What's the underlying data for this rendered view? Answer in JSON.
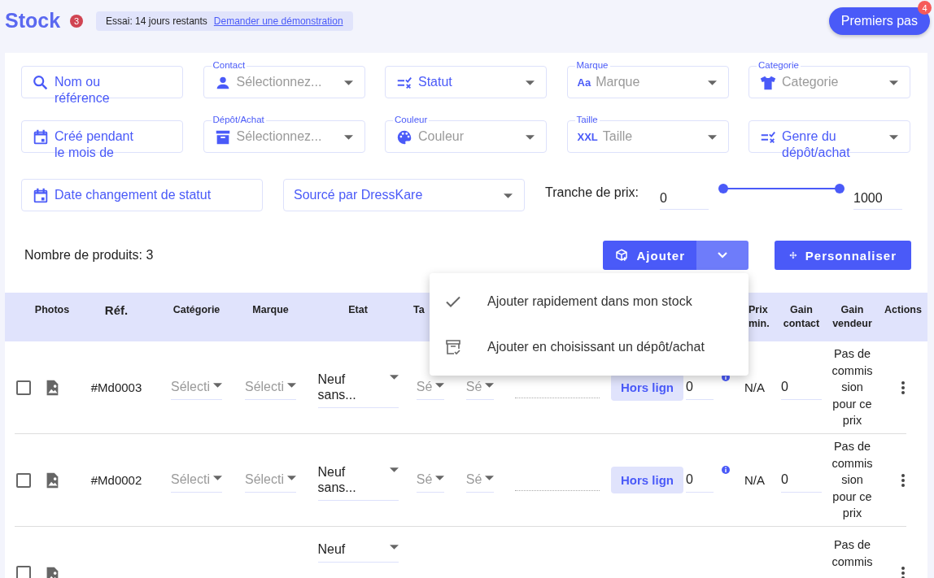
{
  "page": {
    "title": "Stock",
    "notification_count": "3"
  },
  "trial": {
    "text": "Essai: 14 jours restants",
    "link": "Demander une démonstration"
  },
  "help_button": {
    "label": "Premiers pas",
    "badge": "4"
  },
  "filters": [
    {
      "kind": "search",
      "text": "Nom ou référence"
    },
    {
      "kind": "contact",
      "label": "Contact",
      "placeholder": "Sélectionnez..."
    },
    {
      "kind": "status",
      "text": "Statut"
    },
    {
      "kind": "brand",
      "label": "Marque",
      "icon_text": "Aa",
      "placeholder": "Marque"
    },
    {
      "kind": "category",
      "label": "Categorie",
      "placeholder": "Categorie"
    },
    {
      "kind": "month",
      "text": "Créé pendant le mois de"
    },
    {
      "kind": "deposit",
      "label": "Dépôt/Achat",
      "placeholder": "Sélectionnez..."
    },
    {
      "kind": "color",
      "label": "Couleur",
      "placeholder": "Couleur"
    },
    {
      "kind": "size",
      "label": "Taille",
      "icon_text": "XXL",
      "placeholder": "Taille"
    },
    {
      "kind": "genre",
      "text": "Genre du dépôt/achat"
    },
    {
      "kind": "date",
      "text": "Date changement de statut"
    },
    {
      "kind": "source",
      "text": "Sourcé par DressKare"
    }
  ],
  "price_range": {
    "label": "Tranche de prix:",
    "min": "0",
    "max": "1000",
    "level": 1
  },
  "toolbar": {
    "count": "Nombre de produits: 3",
    "add_button": "Ajouter",
    "customize_button": "Personnaliser"
  },
  "add_menu": [
    {
      "label": "Ajouter rapidement dans mon stock"
    },
    {
      "label": "Ajouter en choisissant un dépôt/achat"
    }
  ],
  "table": {
    "columns": [
      {
        "kind": "photos",
        "label": "Photos"
      },
      {
        "kind": "ref",
        "label": "Réf."
      },
      {
        "kind": "category",
        "label": "Catégorie"
      },
      {
        "kind": "brand",
        "label": "Marque"
      },
      {
        "kind": "condition",
        "label": "Etat"
      },
      {
        "kind": "size",
        "label": "Ta"
      },
      {
        "kind": "min_price",
        "label": "Prix min."
      },
      {
        "kind": "contact_gain",
        "label": "Gain contact"
      },
      {
        "kind": "seller_gain",
        "label": "Gain vendeur"
      },
      {
        "kind": "actions",
        "label": "Actions"
      }
    ],
    "rows": [
      {
        "checked": false,
        "ref": "#Md0003",
        "category": "Sélecti",
        "brand": "Sélecti",
        "condition": "Neuf sans...",
        "size": "Sé",
        "column_7": "Sé",
        "status": "Hors lign",
        "price": "0",
        "min_price": "N/A",
        "contact_gain": "0",
        "seller_gain": "Pas de commission pour ce prix"
      },
      {
        "checked": false,
        "ref": "#Md0002",
        "category": "Sélecti",
        "brand": "Sélecti",
        "condition": "Neuf sans...",
        "size": "Sé",
        "column_7": "Sé",
        "status": "Hors lign",
        "price": "0",
        "min_price": "N/A",
        "contact_gain": "0",
        "seller_gain": "Pas de commission pour ce prix"
      },
      {
        "checked": false,
        "condition": "Neuf",
        "seller_gain": "Pas de commis"
      }
    ]
  }
}
